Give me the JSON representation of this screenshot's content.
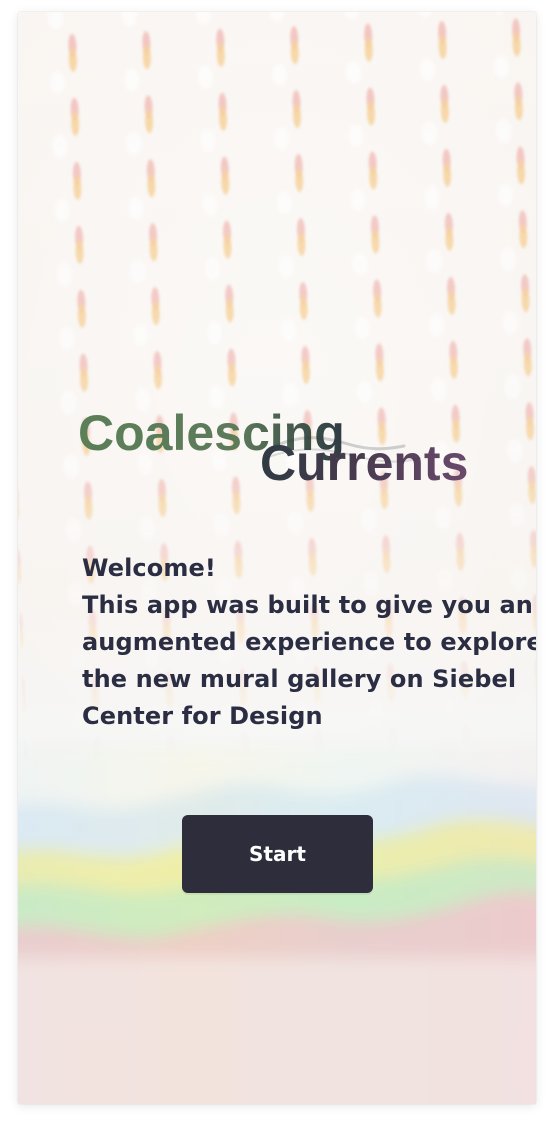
{
  "app": {
    "title_words": [
      "Coalescing",
      "Currents"
    ]
  },
  "intro": {
    "lines": [
      "Welcome!",
      "This app was built to give you an",
      "augmented experience to explore",
      "the new mural gallery on Siebel",
      "Center for Design"
    ]
  },
  "actions": {
    "start_label": "Start"
  },
  "colors": {
    "button_bg": "#2d2d3b",
    "button_text": "#ffffff",
    "body_text": "#2b2e43",
    "title_green": "#5d7a5b",
    "title_purple": "#6a4a6c"
  }
}
